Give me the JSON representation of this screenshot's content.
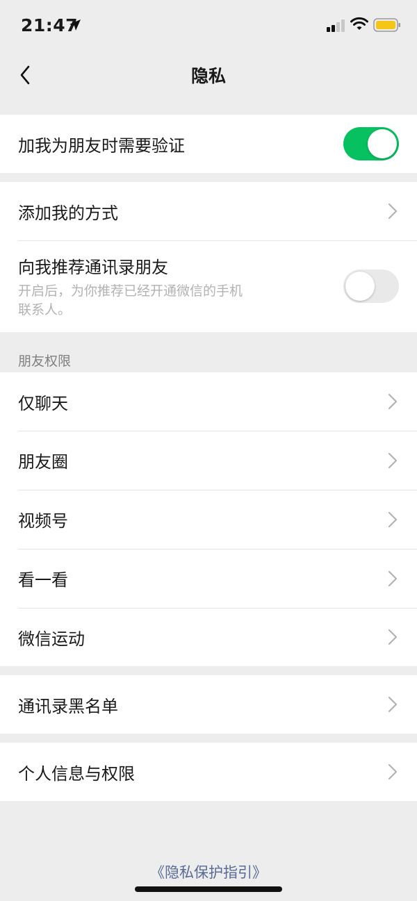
{
  "status_bar": {
    "time": "21:47",
    "location_icon": "location-arrow-icon",
    "signal_icon": "cellular-signal-icon",
    "wifi_icon": "wifi-icon",
    "battery_icon": "battery-icon",
    "battery_color": "#f5c518"
  },
  "nav": {
    "back_icon": "chevron-left-icon",
    "title": "隐私"
  },
  "colors": {
    "toggle_on": "#07c160",
    "toggle_off": "#e9e9ea",
    "link": "#576b95",
    "background": "#ededed"
  },
  "friend_verify": {
    "label": "加我为朋友时需要验证",
    "toggle_on": true
  },
  "add_methods": {
    "label": "添加我的方式"
  },
  "recommend_contacts": {
    "label": "向我推荐通讯录朋友",
    "description": "开启后，为你推荐已经开通微信的手机联系人。",
    "toggle_on": false
  },
  "friend_permissions": {
    "header": "朋友权限",
    "items": [
      {
        "label": "仅聊天"
      },
      {
        "label": "朋友圈"
      },
      {
        "label": "视频号"
      },
      {
        "label": "看一看"
      },
      {
        "label": "微信运动"
      }
    ]
  },
  "blacklist": {
    "label": "通讯录黑名单"
  },
  "personal_info": {
    "label": "个人信息与权限"
  },
  "footer": {
    "link": "《隐私保护指引》"
  }
}
